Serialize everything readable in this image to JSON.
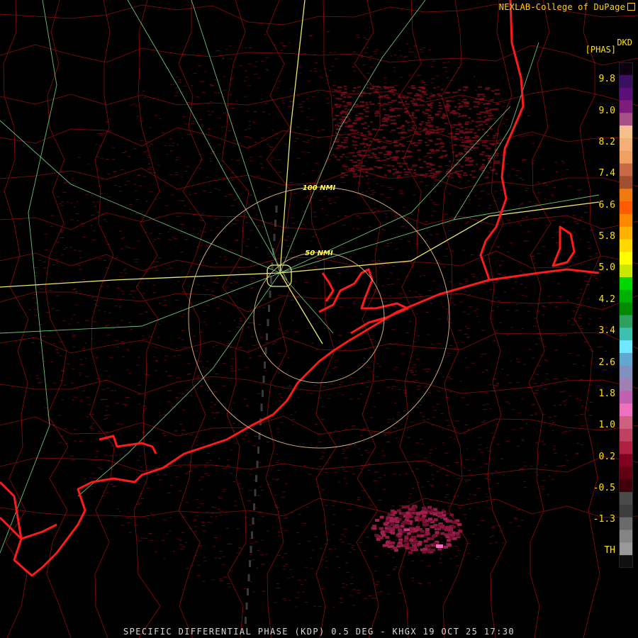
{
  "credit": "NEXLAB-College of DuPage",
  "product_code": "DKD",
  "units": "[PHAS]",
  "footer": "SPECIFIC DIFFERENTIAL PHASE (KDP) 0.5 DEG - KHGX 19 OCT 25 17:30",
  "range_rings": [
    {
      "label": "50 NMI",
      "range_nmi": 50
    },
    {
      "label": "100 NMI",
      "range_nmi": 100
    }
  ],
  "color_scale": {
    "labels": [
      "9.8",
      "9.0",
      "8.2",
      "7.4",
      "6.6",
      "5.8",
      "5.0",
      "4.2",
      "3.4",
      "2.6",
      "1.8",
      "1.0",
      "0.2",
      "-0.5",
      "-1.3",
      "TH"
    ],
    "colors": [
      "#0c0010",
      "#3a1060",
      "#5a1078",
      "#7e1c7c",
      "#a85088",
      "#f5c08c",
      "#f5b07a",
      "#f0a060",
      "#c86a44",
      "#a05030",
      "#f07a10",
      "#ff5a00",
      "#ff8800",
      "#ffb000",
      "#ffd800",
      "#ffff00",
      "#c8e800",
      "#00d800",
      "#00b000",
      "#008a00",
      "#30a060",
      "#3cc0b0",
      "#70e8ff",
      "#60a8d0",
      "#8090c0",
      "#a080b0",
      "#c060b0",
      "#f070c0",
      "#d06080",
      "#c04060",
      "#b02040",
      "#800020",
      "#600010",
      "#400008",
      "#4a4a4a",
      "#3c3c3c",
      "#6a6a6a",
      "#848484",
      "#999999",
      "#101010"
    ]
  },
  "colors": {
    "coastline": "#ff1a1a",
    "county_lines": "#c01010",
    "highways": "#7fdf8a",
    "interstates": "#e8e86a",
    "rings": "#f0c890",
    "echo": "#6a0818"
  }
}
